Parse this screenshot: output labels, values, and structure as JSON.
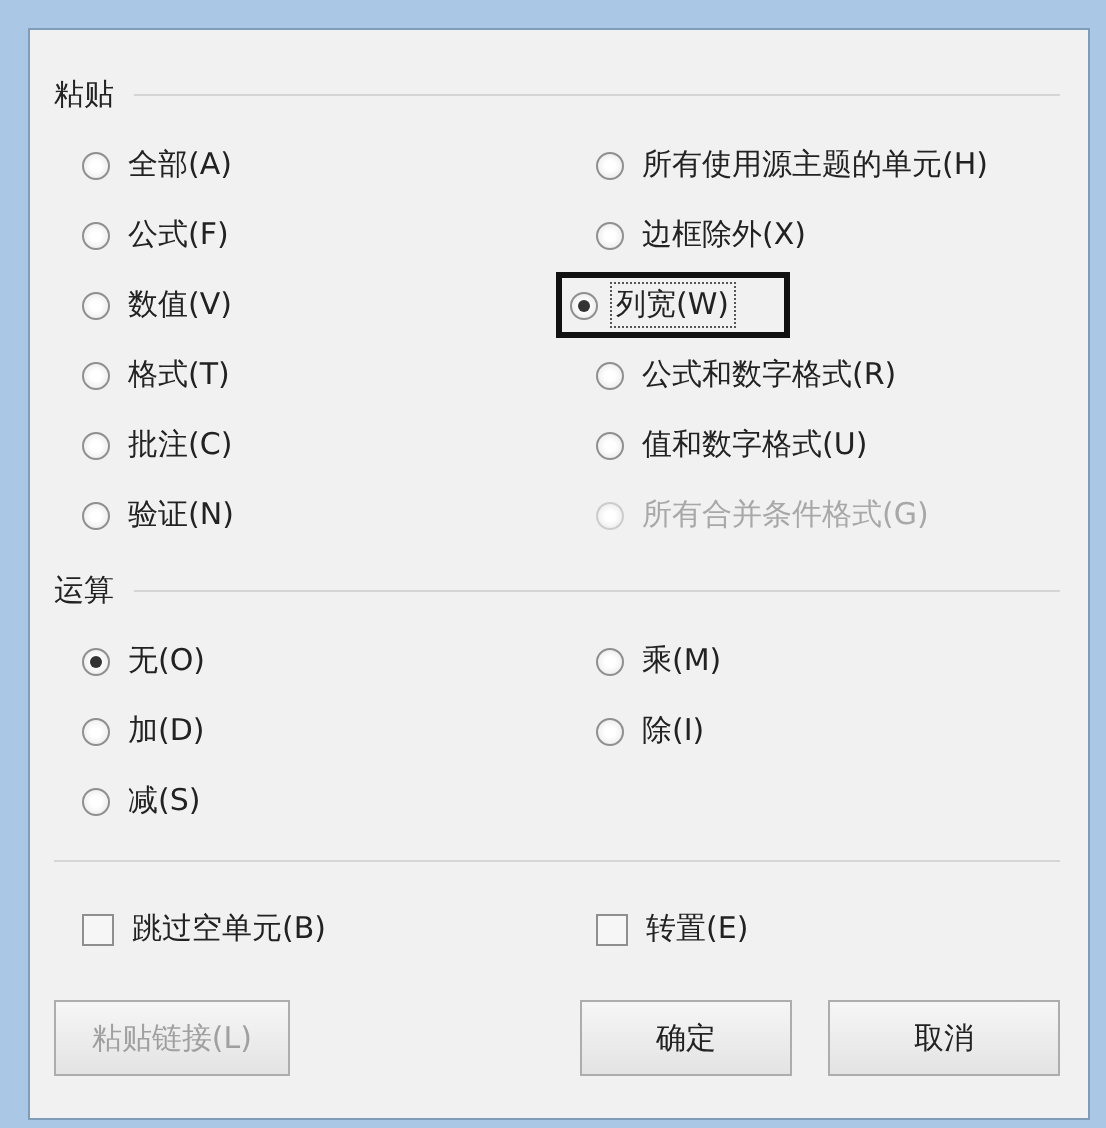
{
  "paste": {
    "title": "粘贴",
    "options": [
      {
        "label": "全部(A)",
        "selected": false,
        "disabled": false,
        "highlighted": false
      },
      {
        "label": "所有使用源主题的单元(H)",
        "selected": false,
        "disabled": false,
        "highlighted": false
      },
      {
        "label": "公式(F)",
        "selected": false,
        "disabled": false,
        "highlighted": false
      },
      {
        "label": "边框除外(X)",
        "selected": false,
        "disabled": false,
        "highlighted": false
      },
      {
        "label": "数值(V)",
        "selected": false,
        "disabled": false,
        "highlighted": false
      },
      {
        "label": "列宽(W)",
        "selected": true,
        "disabled": false,
        "highlighted": true
      },
      {
        "label": "格式(T)",
        "selected": false,
        "disabled": false,
        "highlighted": false
      },
      {
        "label": "公式和数字格式(R)",
        "selected": false,
        "disabled": false,
        "highlighted": false
      },
      {
        "label": "批注(C)",
        "selected": false,
        "disabled": false,
        "highlighted": false
      },
      {
        "label": "值和数字格式(U)",
        "selected": false,
        "disabled": false,
        "highlighted": false
      },
      {
        "label": "验证(N)",
        "selected": false,
        "disabled": false,
        "highlighted": false
      },
      {
        "label": "所有合并条件格式(G)",
        "selected": false,
        "disabled": true,
        "highlighted": false
      }
    ]
  },
  "operation": {
    "title": "运算",
    "options": [
      {
        "label": "无(O)",
        "selected": true,
        "disabled": false,
        "highlighted": false
      },
      {
        "label": "乘(M)",
        "selected": false,
        "disabled": false,
        "highlighted": false
      },
      {
        "label": "加(D)",
        "selected": false,
        "disabled": false,
        "highlighted": false
      },
      {
        "label": "除(I)",
        "selected": false,
        "disabled": false,
        "highlighted": false
      },
      {
        "label": "减(S)",
        "selected": false,
        "disabled": false,
        "highlighted": false
      }
    ]
  },
  "checkboxes": [
    {
      "label": "跳过空单元(B)",
      "checked": false
    },
    {
      "label": "转置(E)",
      "checked": false
    }
  ],
  "buttons": [
    {
      "label": "粘贴链接(L)",
      "disabled": true
    },
    {
      "label": "确定",
      "disabled": false
    },
    {
      "label": "取消",
      "disabled": false
    }
  ]
}
